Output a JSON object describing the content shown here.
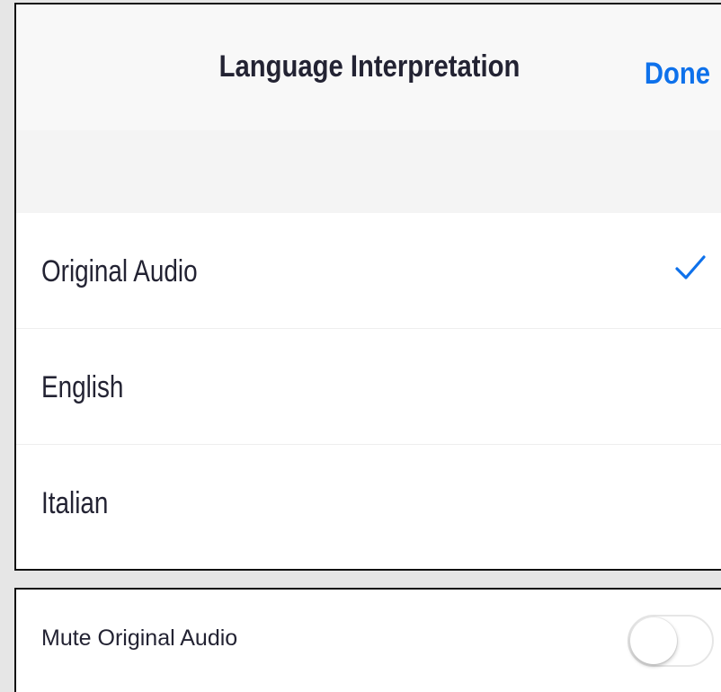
{
  "header": {
    "title": "Language Interpretation",
    "done_label": "Done"
  },
  "languages": [
    {
      "label": "Original Audio",
      "selected": true
    },
    {
      "label": "English",
      "selected": false
    },
    {
      "label": "Italian",
      "selected": false
    }
  ],
  "mute_original_audio": {
    "label": "Mute Original Audio",
    "enabled": false
  },
  "colors": {
    "accent": "#0e71eb",
    "text": "#232333",
    "header_bg": "#f8f8f8",
    "page_bg": "#e6e6e6"
  },
  "icons": {
    "selected_marker": "checkmark-icon"
  }
}
